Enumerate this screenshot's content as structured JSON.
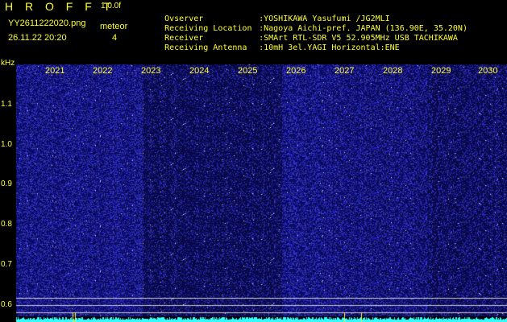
{
  "header": {
    "brand": "H R O F F T",
    "version": "1.0.0f",
    "file_name": "YY2611222020.png",
    "meteor_label": "meteor",
    "timestamp": "26.11.22 20:20",
    "meteor_count": "4"
  },
  "station_info": [
    {
      "key": "Ovserver",
      "value": ":YOSHIKAWA Yasufumi /JG2MLI"
    },
    {
      "key": "Receiving Location",
      "value": ":Nagoya Aichi-pref. JAPAN (136.90E, 35.20N)"
    },
    {
      "key": "Receiver",
      "value": ":SMArt RTL-SDR V5 52.905MHz USB TACHIKAWA"
    },
    {
      "key": "Receiving Antenna",
      "value": ":10mH 3el.YAGI Horizontal:ENE"
    }
  ],
  "axis": {
    "unit": "kHz",
    "y_ticks": [
      "1.1",
      "1.0",
      "0.9",
      "0.8",
      "0.7",
      "0.6"
    ],
    "x_labels": [
      "2021",
      "2022",
      "2023",
      "2024",
      "2025",
      "2026",
      "2027",
      "2028",
      "2029",
      "2030"
    ]
  },
  "colors": {
    "text": "#ffff33",
    "background": "#000000",
    "noise_bright": "#3a3ae0",
    "noise_dark": "#14145a",
    "baseline": "#33ffff",
    "grid": "#ffffff"
  }
}
